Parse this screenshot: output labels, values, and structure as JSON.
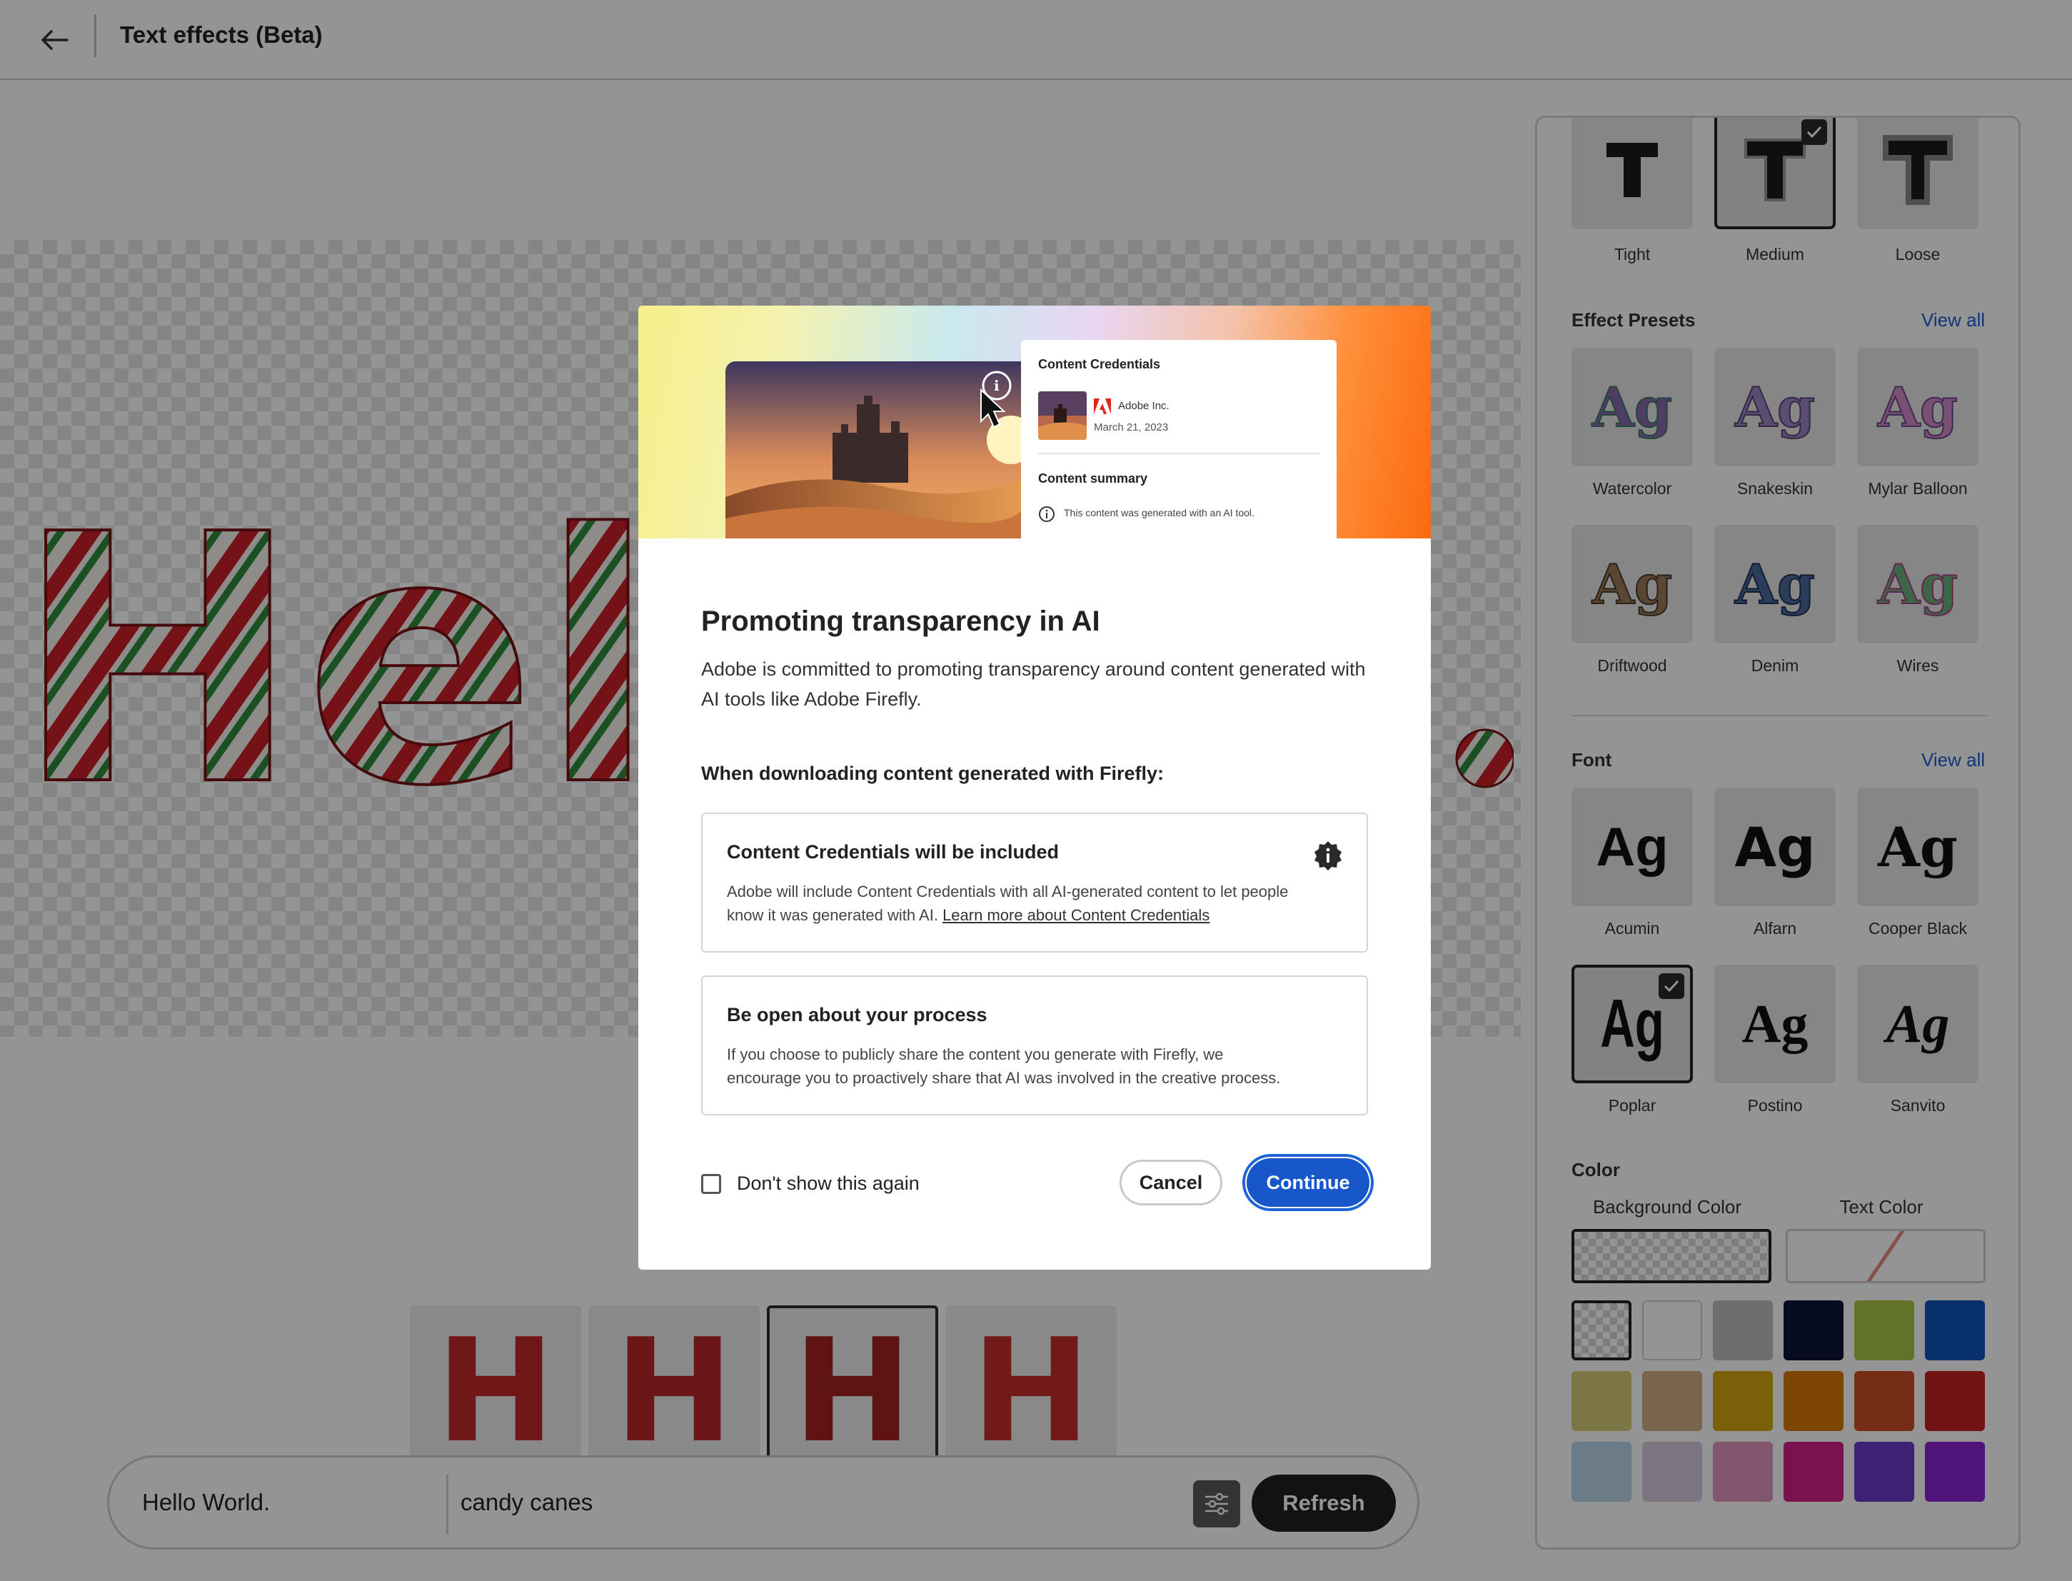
{
  "header": {
    "title": "Text effects (Beta)"
  },
  "canvas": {
    "text": "Hello",
    "partial_suffix": "."
  },
  "thumbnails": [
    {
      "letter": "H",
      "selected": false
    },
    {
      "letter": "H",
      "selected": false
    },
    {
      "letter": "H",
      "selected": true
    },
    {
      "letter": "H",
      "selected": false
    }
  ],
  "prompt": {
    "text_value": "Hello World.",
    "style_value": "candy canes",
    "refresh_label": "Refresh"
  },
  "panel": {
    "fit": {
      "items": [
        {
          "label": "Tight",
          "selected": false
        },
        {
          "label": "Medium",
          "selected": true
        },
        {
          "label": "Loose",
          "selected": false
        }
      ]
    },
    "effect_presets": {
      "title": "Effect Presets",
      "view_all": "View all",
      "items": [
        {
          "label": "Watercolor",
          "glyph": "Ag"
        },
        {
          "label": "Snakeskin",
          "glyph": "Ag"
        },
        {
          "label": "Mylar Balloon",
          "glyph": "Ag"
        },
        {
          "label": "Driftwood",
          "glyph": "Ag"
        },
        {
          "label": "Denim",
          "glyph": "Ag"
        },
        {
          "label": "Wires",
          "glyph": "Ag"
        }
      ]
    },
    "font": {
      "title": "Font",
      "view_all": "View all",
      "items": [
        {
          "label": "Acumin",
          "glyph": "Ag",
          "selected": false
        },
        {
          "label": "Alfarn",
          "glyph": "Ag",
          "selected": false
        },
        {
          "label": "Cooper Black",
          "glyph": "Ag",
          "selected": false
        },
        {
          "label": "Poplar",
          "glyph": "Ag",
          "selected": true
        },
        {
          "label": "Postino",
          "glyph": "Ag",
          "selected": false
        },
        {
          "label": "Sanvito",
          "glyph": "Ag",
          "selected": false
        }
      ]
    },
    "color": {
      "title": "Color",
      "background_label": "Background Color",
      "text_label": "Text Color",
      "swatches": [
        "transparent",
        "#ffffff",
        "#bdbdbd",
        "#0b1633",
        "#a7c448",
        "#0f53b8",
        "#d6cc7a",
        "#cfae82",
        "#d2a50e",
        "#d8780b",
        "#cc4f26",
        "#c42424",
        "#b9d4e8",
        "#d8c8e0",
        "#de94bd",
        "#d2208a",
        "#6a3cc8",
        "#8a22d0"
      ]
    }
  },
  "dialog": {
    "hero": {
      "card_title": "Content Credentials",
      "org": "Adobe Inc.",
      "date": "March 21, 2023",
      "summary_title": "Content summary",
      "summary_text": "This content was generated with an AI tool."
    },
    "title": "Promoting transparency in AI",
    "body": "Adobe is committed to promoting transparency around content generated with AI tools like Adobe Firefly.",
    "subheading": "When downloading content generated with Firefly:",
    "box1": {
      "title": "Content Credentials will be included",
      "text": "Adobe will include Content Credentials with all AI-generated content to let people know it was generated with AI.",
      "link": "Learn more about Content Credentials"
    },
    "box2": {
      "title": "Be open about your process",
      "text": "If you choose to publicly share the content you generate with Firefly, we encourage you to proactively share that AI was involved in the creative process."
    },
    "checkbox_label": "Don't show this again",
    "cancel_label": "Cancel",
    "continue_label": "Continue"
  }
}
